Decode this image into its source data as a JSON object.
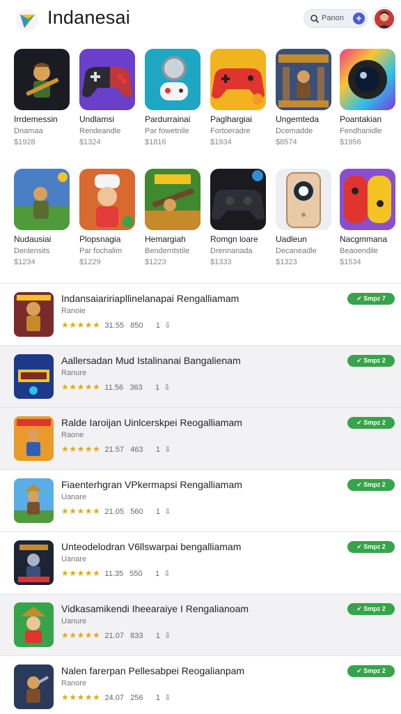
{
  "header": {
    "title": "Indanesai",
    "search_placeholder": "Panon",
    "plus_label": "+"
  },
  "featured_row_1": [
    {
      "name": "Irrdemessin",
      "sub": "Dnamaa",
      "price": "$1928",
      "icon": "soldier-icon"
    },
    {
      "name": "Undlamsi",
      "sub": "Rendeandle",
      "price": "$1324",
      "icon": "gamepad-icon"
    },
    {
      "name": "Pardurrainai",
      "sub": "Par fowetnile",
      "price": "$1816",
      "icon": "controller-magnifier-icon"
    },
    {
      "name": "Paglhargiai",
      "sub": "Fortoeradre",
      "price": "$1934",
      "icon": "red-controller-icon"
    },
    {
      "name": "Ungemteda",
      "sub": "Dcemadde",
      "price": "$8574",
      "icon": "castle-soldier-icon"
    },
    {
      "name": "Poantakian",
      "sub": "Fendhanidle",
      "price": "$1956",
      "icon": "camera-lens-icon"
    }
  ],
  "featured_row_2": [
    {
      "name": "Nudausiai",
      "sub": "Denlensits",
      "price": "$1234",
      "icon": "field-soldier-icon"
    },
    {
      "name": "Plopsnagia",
      "sub": "Par fochalim",
      "price": "$1229",
      "icon": "chef-boy-icon"
    },
    {
      "name": "Hemargiah",
      "sub": "Benderntstile",
      "price": "$1223",
      "icon": "rifle-icon"
    },
    {
      "name": "Romgn loare",
      "sub": "Drennanada",
      "price": "$1333",
      "icon": "black-controller-icon"
    },
    {
      "name": "Uadleun",
      "sub": "Decaneadle",
      "price": "$1323",
      "icon": "phone-device-icon"
    },
    {
      "name": "Nacgmmana",
      "sub": "Beaoendile",
      "price": "$1534",
      "icon": "switch-controller-icon"
    }
  ],
  "list": [
    {
      "title": "Indansaiaririapllinelanapai Rengalliamam",
      "dev": "Ranoie",
      "stars": "★★★★★",
      "rating": "31.55",
      "count": "850",
      "one": "1",
      "badge": "✔ Smpz 7"
    },
    {
      "title": "Aallersadan Mud Istalinanai Bangalienam",
      "dev": "Ranure",
      "stars": "★★★★★",
      "rating": "11.56",
      "count": "363",
      "one": "1",
      "badge": "✔ Smpz 2"
    },
    {
      "title": "Ralde Iaroijan Uinlcerskpei Reogalliamam",
      "dev": "Raone",
      "stars": "★★★★★",
      "rating": "21.57",
      "count": "463",
      "one": "1",
      "badge": "✔ Smpz 2"
    },
    {
      "title": "Fiaenterhgran VPkermapsi  Rengalliamam",
      "dev": "Uanare",
      "stars": "★★★★★",
      "rating": "21.05",
      "count": "560",
      "one": "1",
      "badge": "✔ Smpz 2"
    },
    {
      "title": "Unteodelodran V6llswarpai bengalliamam",
      "dev": "Uanare",
      "stars": "★★★★★",
      "rating": "11.35",
      "count": "550",
      "one": "1",
      "badge": "✔ Smpz 2"
    },
    {
      "title": "Vidkasamikendi Iheearaiye I Rengalianoam",
      "dev": "Uanure",
      "stars": "★★★★★",
      "rating": "21.07",
      "count": "833",
      "one": "1",
      "badge": "✔ Smpz 2"
    },
    {
      "title": "Nalen farerpan Pellesabpei Reogalianpam",
      "dev": "Ranore",
      "stars": "★★★★★",
      "rating": "24.07",
      "count": "256",
      "one": "1",
      "badge": "✔ Smpz 2"
    }
  ],
  "colors": {
    "accent": "#4a5ad8",
    "badge": "#36a44a",
    "stars": "#e2a91a"
  }
}
